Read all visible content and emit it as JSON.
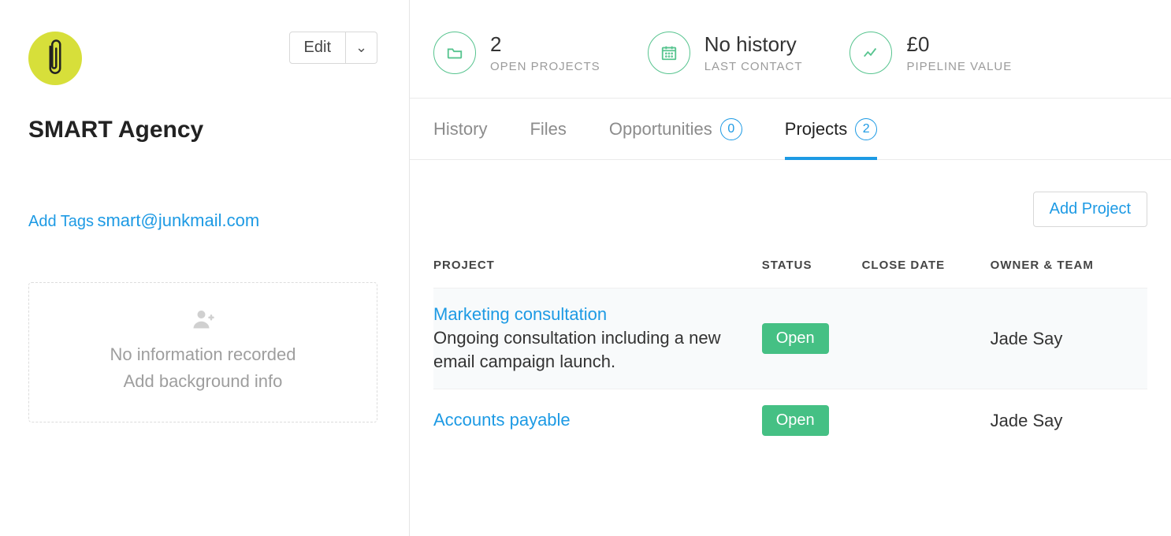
{
  "sidebar": {
    "title": "SMART Agency",
    "edit_label": "Edit",
    "add_tags_label": "Add Tags",
    "email": "smart@junkmail.com",
    "bg_card": {
      "no_info": "No information recorded",
      "add_bg": "Add background info"
    }
  },
  "stats": {
    "open_projects": {
      "value": "2",
      "label": "OPEN PROJECTS"
    },
    "last_contact": {
      "value": "No history",
      "label": "LAST CONTACT"
    },
    "pipeline": {
      "value": "£0",
      "label": "PIPELINE VALUE"
    }
  },
  "tabs": {
    "history": "History",
    "files": "Files",
    "opportunities": {
      "label": "Opportunities",
      "count": "0"
    },
    "projects": {
      "label": "Projects",
      "count": "2"
    }
  },
  "projects_panel": {
    "add_button": "Add Project",
    "columns": {
      "project": "PROJECT",
      "status": "STATUS",
      "close_date": "CLOSE DATE",
      "owner": "OWNER & TEAM"
    },
    "rows": [
      {
        "name": "Marketing consultation",
        "desc": "Ongoing consultation including a new email campaign launch.",
        "status": "Open",
        "close_date": "",
        "owner": "Jade Say"
      },
      {
        "name": "Accounts payable",
        "desc": "",
        "status": "Open",
        "close_date": "",
        "owner": "Jade Say"
      }
    ]
  }
}
